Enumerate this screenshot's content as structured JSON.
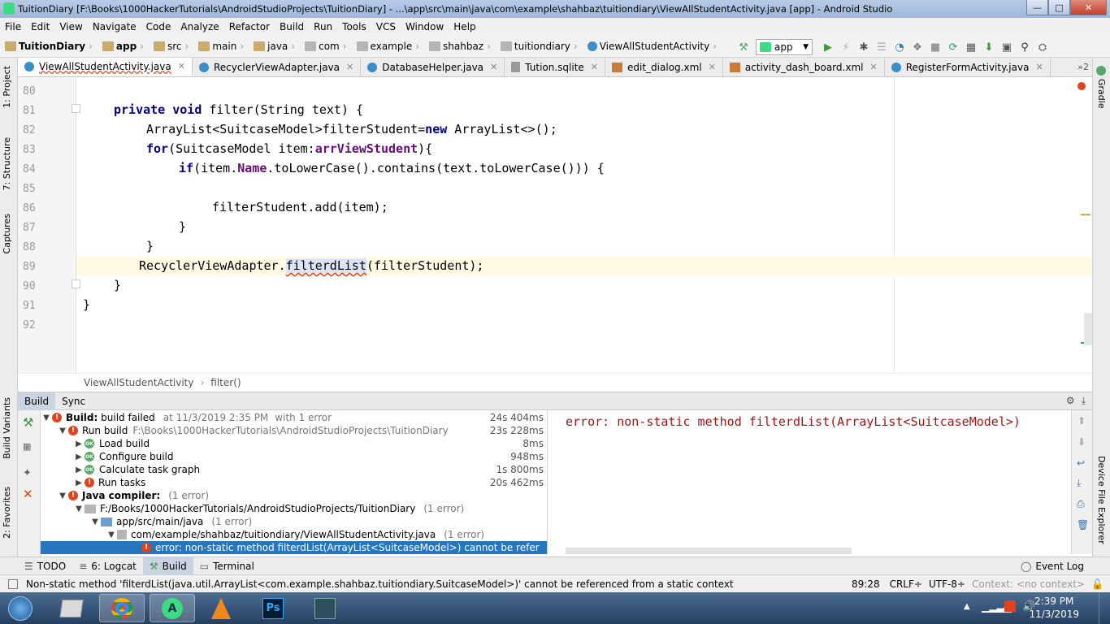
{
  "window": {
    "title": "TuitionDiary [F:\\Books\\1000HackerTutorials\\AndroidStudioProjects\\TuitionDiary] - ...\\app\\src\\main\\java\\com\\example\\shahbaz\\tuitiondiary\\ViewAllStudentActivity.java [app] - Android Studio"
  },
  "menu": [
    "File",
    "Edit",
    "View",
    "Navigate",
    "Code",
    "Analyze",
    "Refactor",
    "Build",
    "Run",
    "Tools",
    "VCS",
    "Window",
    "Help"
  ],
  "breadcrumbs": [
    "TuitionDiary",
    "app",
    "src",
    "main",
    "java",
    "com",
    "example",
    "shahbaz",
    "tuitiondiary",
    "ViewAllStudentActivity"
  ],
  "run_config": "app",
  "tabs": [
    "ViewAllStudentActivity.java",
    "RecyclerViewAdapter.java",
    "DatabaseHelper.java",
    "Tution.sqlite",
    "edit_dialog.xml",
    "activity_dash_board.xml",
    "RegisterFormActivity.java"
  ],
  "tabs_overflow": "»2",
  "left_tools": [
    "1: Project",
    "7: Structure",
    "Captures",
    "Build Variants",
    "2: Favorites"
  ],
  "right_tools": [
    "Gradle",
    "Device File Explorer"
  ],
  "code": {
    "line_numbers": [
      "80",
      "81",
      "82",
      "83",
      "84",
      "85",
      "86",
      "87",
      "88",
      "89",
      "90",
      "91",
      "92"
    ],
    "line81": {
      "kw1": "private",
      "kw2": "void",
      "rest": " filter(String text) {"
    },
    "line82": {
      "a": "ArrayList<SuitcaseModel>filterStudent=",
      "kw": "new",
      "b": " ArrayList<>();"
    },
    "line83": {
      "kw": "for",
      "a": "(SuitcaseModel item:",
      "fld": "arrViewStudent",
      "b": "){"
    },
    "line84": {
      "kw": "if",
      "a": "(item.",
      "fld": "Name",
      "b": ".toLowerCase().contains(text.toLowerCase())) {"
    },
    "line86": "filterStudent.add(item);",
    "line87": "}",
    "line88": "}",
    "line89": {
      "a": "RecyclerViewAdapter.",
      "sel": "filterdList",
      "b": "(filterStudent);"
    },
    "line90": "}",
    "line91": "}"
  },
  "editor_breadcrumb": [
    "ViewAllStudentActivity",
    "filter()"
  ],
  "build_tabs": [
    "Build",
    "Sync"
  ],
  "build_tree": [
    {
      "label": "Build:",
      "bold": true,
      "status": "build failed",
      "extra": "at 11/3/2019 2:35 PM",
      "extra2": "with 1 error",
      "dur": "24s 404ms"
    },
    {
      "label": "Run build",
      "path": "F:\\Books\\1000HackerTutorials\\AndroidStudioProjects\\TuitionDiary",
      "dur": "23s 228ms"
    },
    {
      "label": "Load build",
      "dur": "8ms"
    },
    {
      "label": "Configure build",
      "dur": "948ms"
    },
    {
      "label": "Calculate task graph",
      "dur": "1s 800ms"
    },
    {
      "label": "Run tasks",
      "dur": "20s 462ms"
    },
    {
      "label": "Java compiler:",
      "count": "(1 error)"
    },
    {
      "label": "F:/Books/1000HackerTutorials/AndroidStudioProjects/TuitionDiary",
      "count": "(1 error)"
    },
    {
      "label": "app/src/main/java",
      "count": "(1 error)"
    },
    {
      "label": "com/example/shahbaz/tuitiondiary/ViewAllStudentActivity.java",
      "count": "(1 error)"
    },
    {
      "label": "error: non-static method filterdList(ArrayList<SuitcaseModel>) cannot be refer"
    }
  ],
  "ok_badge": "OK",
  "console_message": "error: non-static method filterdList(ArrayList<SuitcaseModel>)",
  "bottom_tools": [
    "TODO",
    "6: Logcat",
    "Build",
    "Terminal"
  ],
  "event_log": "Event Log",
  "status": {
    "message": "Non-static method 'filterdList(java.util.ArrayList<com.example.shahbaz.tuitiondiary.SuitcaseModel>)' cannot be referenced from a static context",
    "position": "89:28",
    "line_sep": "CRLF÷",
    "encoding": "UTF-8÷",
    "context": "Context: <no context>"
  },
  "clock": {
    "time": "2:39 PM",
    "date": "11/3/2019"
  },
  "taskbar_apps": [
    "start",
    "file-explorer",
    "chrome",
    "android-studio",
    "vlc",
    "photoshop",
    "app"
  ]
}
